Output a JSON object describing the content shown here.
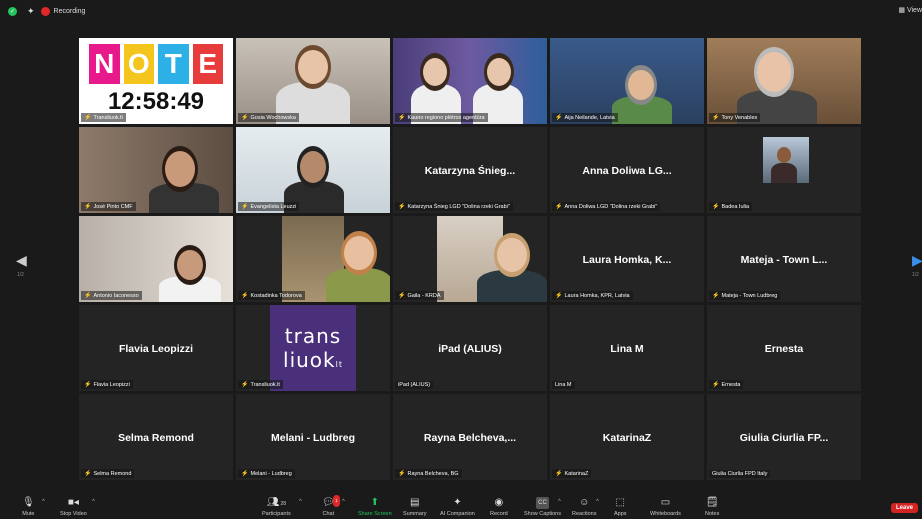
{
  "topbar": {
    "recording_label": "Recording",
    "view_label": "View"
  },
  "pagination": {
    "left": "1/2",
    "right": "1/2"
  },
  "clock": "12:58:49",
  "note_logo_letters": [
    "N",
    "O",
    "T",
    "E"
  ],
  "tiles": [
    {
      "label": "Transliuok.lt",
      "type": "note"
    },
    {
      "label": "Gosia Wochowska",
      "type": "video"
    },
    {
      "label": "Kauno regiono plėtros agentūra",
      "type": "video",
      "active": true
    },
    {
      "label": "Aija Neilande, Latvia",
      "type": "video"
    },
    {
      "label": "Tony Venables",
      "type": "video"
    },
    {
      "label": "José Pinto CMF",
      "type": "video"
    },
    {
      "label": "Evangelista Leuzzi",
      "type": "video"
    },
    {
      "label": "Katarzyna Śnieg LGD \"Dolina rzeki Grabi\"",
      "type": "name",
      "name": "Katarzyna Śnieg..."
    },
    {
      "label": "Anna Doliwa LGD \"Dolina rzeki Grabi\"",
      "type": "name",
      "name": "Anna Doliwa LG..."
    },
    {
      "label": "Badea Iulia",
      "type": "photo"
    },
    {
      "label": "Antonio Iaconesso",
      "type": "video"
    },
    {
      "label": "Kostadinka Todorova",
      "type": "video"
    },
    {
      "label": "Gaila - KRDA",
      "type": "video"
    },
    {
      "label": "Laura Homka, KPR, Latvia",
      "type": "name",
      "name": "Laura Homka, K..."
    },
    {
      "label": "Mateja - Town Ludbreg",
      "type": "name",
      "name": "Mateja - Town L..."
    },
    {
      "label": "Flavia Leopizzi",
      "type": "name",
      "name": "Flavia Leopizzi"
    },
    {
      "label": "Transliuok.lt",
      "type": "trans"
    },
    {
      "label": "iPad (ALIUS)",
      "type": "name",
      "name": "iPad (ALIUS)",
      "unmuted": true
    },
    {
      "label": "Lina M",
      "type": "name",
      "name": "Lina M",
      "unmuted": true
    },
    {
      "label": "Ernesta",
      "type": "name",
      "name": "Ernesta"
    },
    {
      "label": "Selma Remond",
      "type": "name",
      "name": "Selma Remond"
    },
    {
      "label": "Melani - Ludbreg",
      "type": "name",
      "name": "Melani - Ludbreg"
    },
    {
      "label": "Rayna Belcheva, BG",
      "type": "name",
      "name": "Rayna Belcheva,..."
    },
    {
      "label": "KatarinaZ",
      "type": "name",
      "name": "KatarinaZ"
    },
    {
      "label": "Giulia Ciurlia FPD Italy",
      "type": "name",
      "name": "Giulia Ciurlia FP...",
      "unmuted": true
    }
  ],
  "trans_logo": {
    "line1": "trans",
    "line2": "liuok",
    "suffix": "lt"
  },
  "toolbar": {
    "mute": "Mute",
    "stop_video": "Stop Video",
    "participants": "Participants",
    "participants_count": "28",
    "chat": "Chat",
    "chat_badge": "1",
    "share_screen": "Share Screen",
    "summary": "Summary",
    "ai_companion": "AI Companion",
    "record": "Record",
    "show_captions": "Show Captions",
    "captions_icon": "CC",
    "reactions": "Reactions",
    "apps": "Apps",
    "whiteboards": "Whiteboards",
    "notes": "Notes",
    "leave": "Leave"
  },
  "colors": {
    "accent_green": "#23c45e",
    "active_border": "#d8e21a",
    "leave_red": "#d32424",
    "mute_red": "#e02828",
    "trans_purple": "#4a2f7a"
  }
}
